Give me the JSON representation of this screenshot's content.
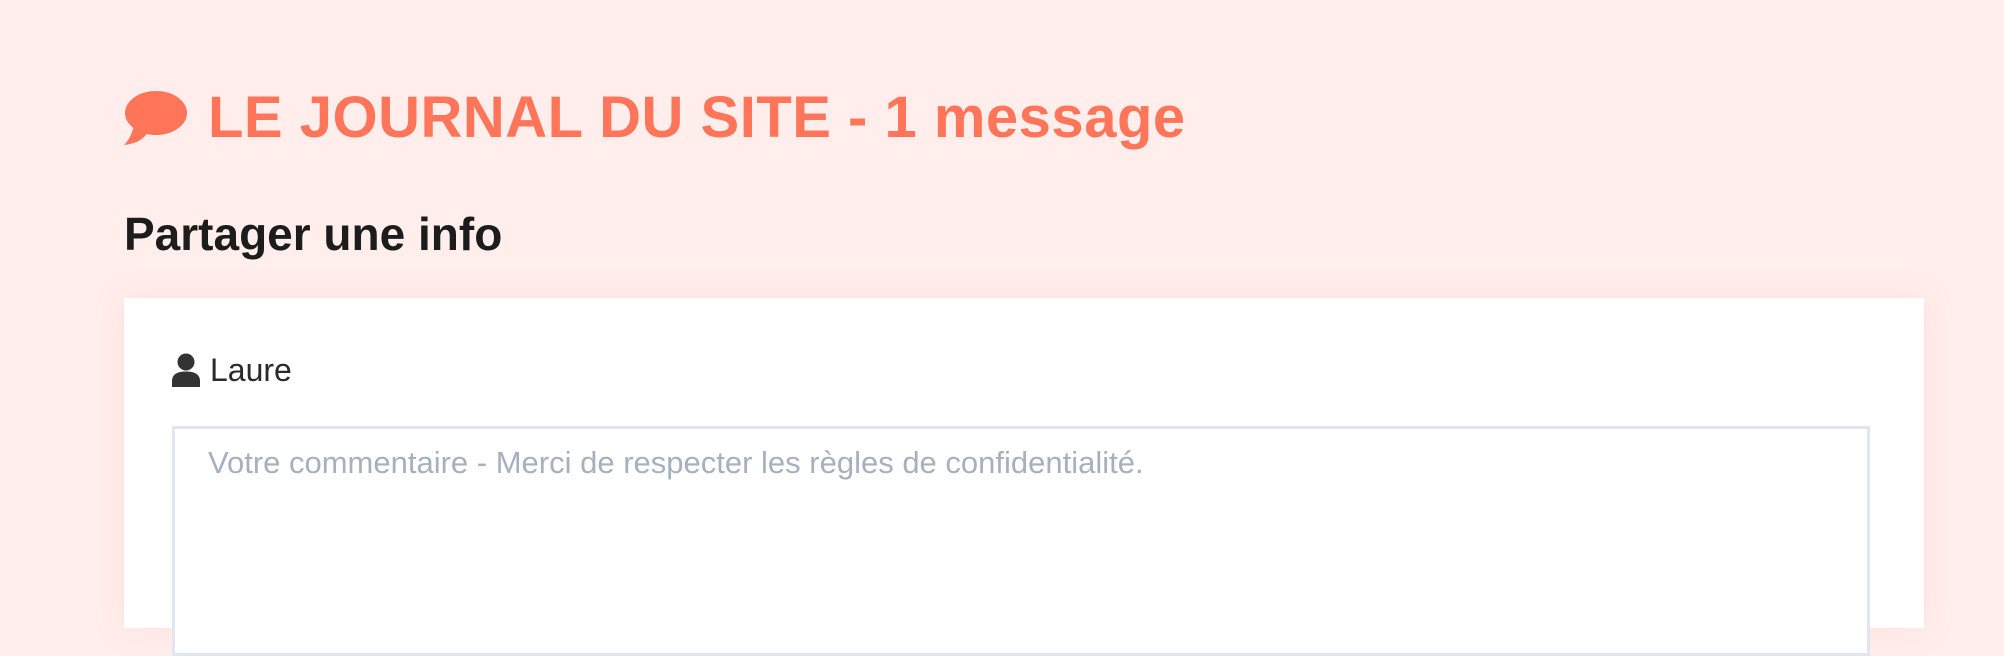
{
  "journal": {
    "title": "LE JOURNAL DU SITE - 1 message",
    "icon": "chat-bubble-icon",
    "accent_color": "#ff7559"
  },
  "share": {
    "heading": "Partager une info",
    "author_name": "Laure",
    "author_icon": "user-icon",
    "comment_placeholder": "Votre commentaire - Merci de respecter les règles de confidentialité."
  }
}
